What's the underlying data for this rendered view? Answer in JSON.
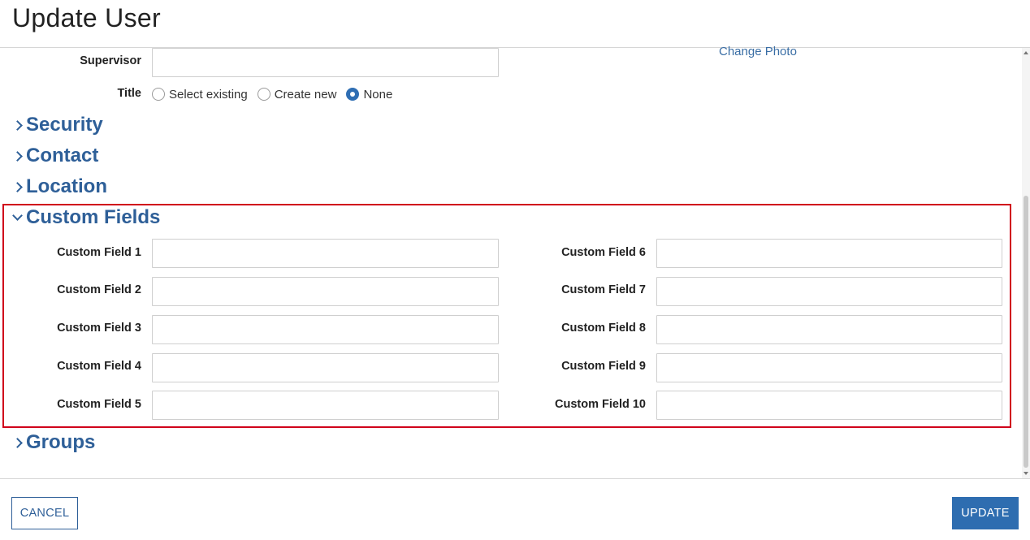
{
  "header": {
    "title": "Update User"
  },
  "supervisor": {
    "label": "Supervisor",
    "value": ""
  },
  "title_field": {
    "label": "Title",
    "options": [
      {
        "label": "Select existing",
        "checked": false
      },
      {
        "label": "Create new",
        "checked": false
      },
      {
        "label": "None",
        "checked": true
      }
    ]
  },
  "photo": {
    "change_label": "Change Photo"
  },
  "sections": {
    "security": "Security",
    "contact": "Contact",
    "location": "Location",
    "custom_fields": "Custom Fields",
    "groups": "Groups"
  },
  "custom_fields": {
    "left": [
      {
        "label": "Custom Field 1",
        "value": ""
      },
      {
        "label": "Custom Field 2",
        "value": ""
      },
      {
        "label": "Custom Field 3",
        "value": ""
      },
      {
        "label": "Custom Field 4",
        "value": ""
      },
      {
        "label": "Custom Field 5",
        "value": ""
      }
    ],
    "right": [
      {
        "label": "Custom Field 6",
        "value": ""
      },
      {
        "label": "Custom Field 7",
        "value": ""
      },
      {
        "label": "Custom Field 8",
        "value": ""
      },
      {
        "label": "Custom Field 9",
        "value": ""
      },
      {
        "label": "Custom Field 10",
        "value": ""
      }
    ]
  },
  "footer": {
    "cancel_label": "CANCEL",
    "update_label": "UPDATE"
  },
  "colors": {
    "accent": "#2e5f98",
    "button": "#2e6db0",
    "highlight": "#d0021b"
  }
}
